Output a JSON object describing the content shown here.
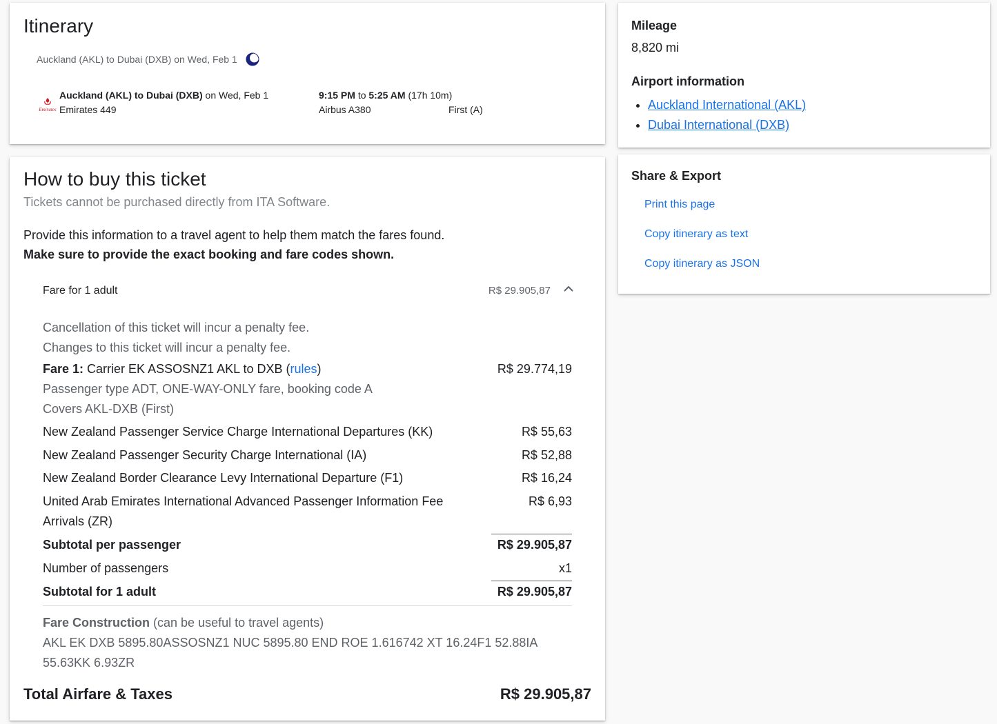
{
  "itinerary": {
    "title": "Itinerary",
    "route_summary": "Auckland (AKL) to Dubai (DXB) on Wed, Feb 1",
    "segment": {
      "route": "Auckland (AKL) to Dubai (DXB)",
      "date": "on Wed, Feb 1",
      "flight": "Emirates 449",
      "depart": "9:15 PM",
      "to_word": "to",
      "arrive": "5:25 AM",
      "duration": "(17h 10m)",
      "aircraft": "Airbus A380",
      "cabin": "First (A)",
      "airline_logo_text": "Emirates"
    }
  },
  "buy": {
    "title": "How to buy this ticket",
    "subtitle": "Tickets cannot be purchased directly from ITA Software.",
    "info1": "Provide this information to a travel agent to help them match the fares found.",
    "info2": "Make sure to provide the exact booking and fare codes shown.",
    "fare_header": {
      "label": "Fare for 1 adult",
      "amount": "R$ 29.905,87"
    },
    "penalties": [
      "Cancellation of this ticket will incur a penalty fee.",
      "Changes to this ticket will incur a penalty fee."
    ],
    "fare1": {
      "label": "Fare 1:",
      "text": "Carrier EK ASSOSNZ1 AKL to DXB (",
      "rules": "rules",
      "close": ")",
      "amount": "R$ 29.774,19",
      "detail1": "Passenger type ADT, ONE-WAY-ONLY fare, booking code A",
      "detail2": "Covers AKL-DXB (First)"
    },
    "taxes": [
      {
        "label": "New Zealand Passenger Service Charge International Departures (KK)",
        "amount": "R$ 55,63"
      },
      {
        "label": "New Zealand Passenger Security Charge International (IA)",
        "amount": "R$ 52,88"
      },
      {
        "label": "New Zealand Border Clearance Levy International Departure (F1)",
        "amount": "R$ 16,24"
      },
      {
        "label": "United Arab Emirates International Advanced Passenger Information Fee",
        "label2": "Arrivals (ZR)",
        "amount": "R$ 6,93"
      }
    ],
    "subtotal_per_passenger": {
      "label": "Subtotal per passenger",
      "amount": "R$ 29.905,87"
    },
    "num_passengers": {
      "label": "Number of passengers",
      "amount": "x1"
    },
    "subtotal_adult": {
      "label": "Subtotal for 1 adult",
      "amount": "R$ 29.905,87"
    },
    "fare_construction": {
      "label": "Fare Construction",
      "note": "(can be useful to travel agents)",
      "line1": "AKL EK DXB 5895.80ASSOSNZ1 NUC 5895.80 END ROE 1.616742 XT 16.24F1 52.88IA",
      "line2": "55.63KK 6.93ZR"
    },
    "total": {
      "label": "Total Airfare & Taxes",
      "amount": "R$ 29.905,87"
    }
  },
  "mileage": {
    "title": "Mileage",
    "value": "8,820 mi",
    "airport_title": "Airport information",
    "airports": [
      "Auckland International (AKL)",
      "Dubai International (DXB)"
    ]
  },
  "share": {
    "title": "Share & Export",
    "actions": [
      "Print this page",
      "Copy itinerary as text",
      "Copy itinerary as JSON"
    ]
  },
  "colors": {
    "link": "#1a73e8",
    "emirates_red": "#d71921",
    "moon_blue": "#1a237e"
  }
}
